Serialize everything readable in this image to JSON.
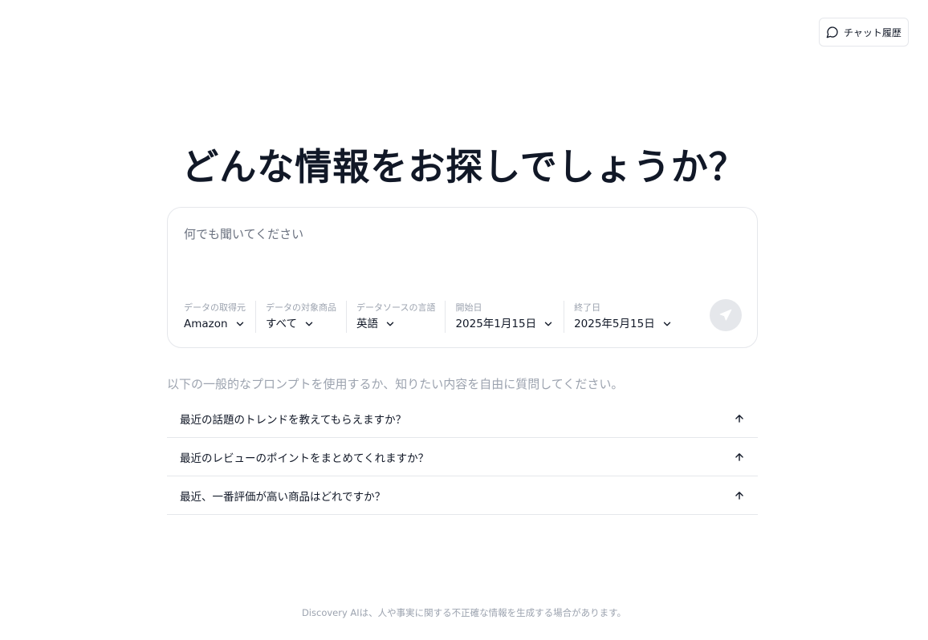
{
  "header": {
    "history_label": "チャット履歴",
    "history_icon": "chat-bubble-icon"
  },
  "headline": "どんな情報をお探しでしょうか？",
  "search": {
    "placeholder": "何でも聞いてください",
    "value": "",
    "send_icon": "send-icon"
  },
  "filters": [
    {
      "label": "データの取得元",
      "value": "Amazon"
    },
    {
      "label": "データの対象商品",
      "value": "すべて"
    },
    {
      "label": "データソースの言語",
      "value": "英語"
    },
    {
      "label": "開始日",
      "value": "2025年1月15日"
    },
    {
      "label": "終了日",
      "value": "2025年5月15日"
    }
  ],
  "prompts": {
    "hint": "以下の一般的なプロンプトを使用するか、知りたい内容を自由に質問してください。",
    "items": [
      "最近の話題のトレンドを教えてもらえますか？",
      "最近のレビューのポイントをまとめてくれますか？",
      "最近、一番評価が高い商品はどれですか？"
    ]
  },
  "footer": "Discovery AIは、人や事実に関する不正確な情報を生成する場合があります。",
  "colors": {
    "text": "#111827",
    "muted": "#9ca3af",
    "border": "#e5e7eb",
    "send_bg": "#e5e7eb"
  }
}
